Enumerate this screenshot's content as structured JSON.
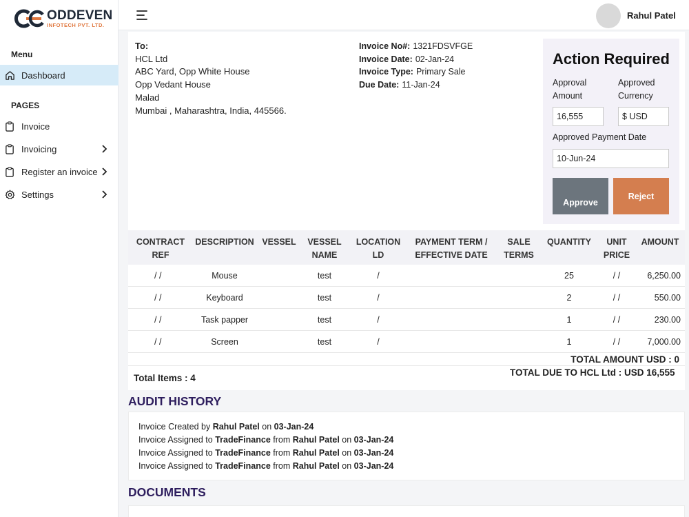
{
  "brand": {
    "name": "ODDEVEN",
    "subtitle": "INFOTECH PVT. LTD.",
    "accent": "#e0783f"
  },
  "sidebar": {
    "menu_label": "Menu",
    "pages_label": "PAGES",
    "items": [
      {
        "label": "Dashboard",
        "icon": "home-icon",
        "active": true
      },
      {
        "label": "Invoice",
        "icon": "clipboard-icon"
      },
      {
        "label": "Invoicing",
        "icon": "clipboard-icon",
        "has_chevron": true
      },
      {
        "label": "Register an invoice",
        "icon": "clipboard-icon",
        "has_chevron": true
      },
      {
        "label": "Settings",
        "icon": "gear-icon",
        "has_chevron": true
      }
    ]
  },
  "header": {
    "user_name": "Rahul Patel",
    "avatar_icon": "avatar-icon",
    "menu_icon": "menu-icon"
  },
  "invoice": {
    "to_label": "To:",
    "to_lines": [
      "HCL Ltd",
      "ABC Yard, Opp White House",
      "Opp Vedant House",
      "Malad",
      "Mumbai , Maharashtra, India, 445566."
    ],
    "details": [
      {
        "label": "Invoice No#:",
        "value": "1321FDSVFGE"
      },
      {
        "label": "Invoice Date:",
        "value": "02-Jan-24"
      },
      {
        "label": "Invoice Type:",
        "value": "Primary Sale"
      },
      {
        "label": "Due Date:",
        "value": "11-Jan-24"
      }
    ]
  },
  "action": {
    "title": "Action Required",
    "amount_label_1": "Approval",
    "amount_label_2": "Amount",
    "amount_value": "16,555",
    "currency_label_1": "Approved",
    "currency_label_2": "Currency",
    "currency_value": "$ USD",
    "date_label": "Approved Payment Date",
    "date_value": "10-Jun-24",
    "approve_label": "Approve",
    "reject_label": "Reject",
    "approve_color": "#6c757d",
    "reject_color": "#d47e4f"
  },
  "table": {
    "headers": [
      [
        "CONTRACT",
        "REF"
      ],
      [
        "DESCRIPTION"
      ],
      [
        "VESSEL"
      ],
      [
        "VESSEL",
        "NAME"
      ],
      [
        "LOCATION",
        "LD"
      ],
      [
        "PAYMENT TERM /",
        "EFFECTIVE DATE"
      ],
      [
        "SALE",
        "TERMS"
      ],
      [
        "QUANTITY"
      ],
      [
        "UNIT",
        "PRICE"
      ],
      [
        "AMOUNT"
      ]
    ],
    "rows": [
      {
        "ref": "/ /",
        "description": "Mouse",
        "vessel_name": "test",
        "location": "/",
        "quantity": "25",
        "unit_price": "/ /",
        "amount": "6,250.00"
      },
      {
        "ref": "/ /",
        "description": "Keyboard",
        "vessel_name": "test",
        "location": "/",
        "quantity": "2",
        "unit_price": "/ /",
        "amount": "550.00"
      },
      {
        "ref": "/ /",
        "description": "Task papper",
        "vessel_name": "test",
        "location": "/",
        "quantity": "1",
        "unit_price": "/ /",
        "amount": "230.00"
      },
      {
        "ref": "/ /",
        "description": "Screen",
        "vessel_name": "test",
        "location": "/",
        "quantity": "1",
        "unit_price": "/ /",
        "amount": "7,000.00"
      }
    ],
    "total_amount": "TOTAL AMOUNT USD : 0",
    "total_items": "Total Items : 4",
    "total_due": "TOTAL DUE TO HCL Ltd : USD 16,555"
  },
  "audit": {
    "title": "AUDIT HISTORY",
    "entries": [
      {
        "prefix": "Invoice Created by ",
        "who": "Rahul Patel",
        "mid": "",
        "from": "",
        "on": " on ",
        "date": "03-Jan-24"
      },
      {
        "prefix": "Invoice Assigned to ",
        "who": "TradeFinance",
        "mid": " from ",
        "from": "Rahul Patel",
        "on": " on ",
        "date": "03-Jan-24"
      },
      {
        "prefix": "Invoice Assigned to ",
        "who": "TradeFinance",
        "mid": " from ",
        "from": "Rahul Patel",
        "on": " on ",
        "date": "03-Jan-24"
      },
      {
        "prefix": "Invoice Assigned to ",
        "who": "TradeFinance",
        "mid": " from ",
        "from": "Rahul Patel",
        "on": " on ",
        "date": "03-Jan-24"
      }
    ]
  },
  "documents": {
    "title": "DOCUMENTS"
  }
}
